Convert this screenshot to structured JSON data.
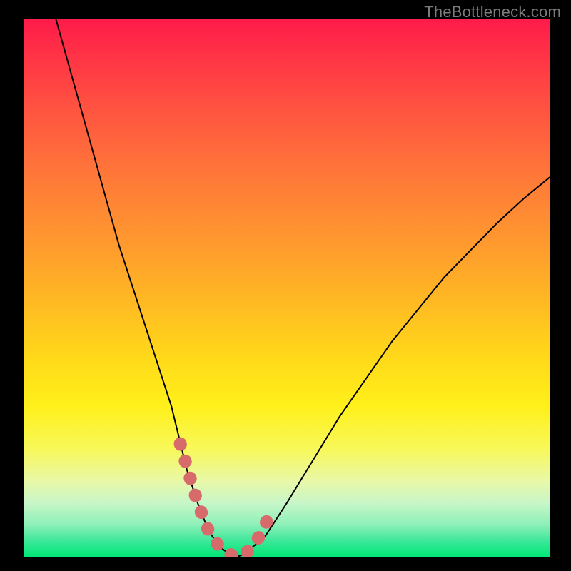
{
  "watermark": "TheBottleneck.com",
  "chart_data": {
    "type": "line",
    "title": "",
    "xlabel": "",
    "ylabel": "",
    "xlim": [
      0,
      100
    ],
    "ylim": [
      0,
      100
    ],
    "grid": false,
    "series": [
      {
        "name": "bottleneck-curve",
        "color": "#000000",
        "stroke_width": 2,
        "x": [
          6,
          8,
          10,
          12,
          14,
          16,
          18,
          20,
          22,
          24,
          26,
          28,
          29.5,
          31,
          33,
          35,
          37,
          39,
          40.5,
          42,
          46,
          50,
          55,
          60,
          65,
          70,
          75,
          80,
          85,
          90,
          95,
          100
        ],
        "y": [
          100,
          93,
          86,
          79,
          72,
          65,
          58,
          52,
          46,
          40,
          34,
          28,
          22,
          16,
          10,
          5,
          2,
          0.5,
          0,
          0.5,
          4,
          10,
          18,
          26,
          33,
          40,
          46,
          52,
          57,
          62,
          66.5,
          70.5
        ]
      },
      {
        "name": "sweet-spot-marker",
        "color": "#d76a6a",
        "stroke_width": 18,
        "stroke_linecap": "round",
        "x": [
          29.7,
          31.3,
          33.0,
          35.0,
          37.0,
          39.0,
          40.5,
          42.0,
          43.6,
          45.2,
          46.8
        ],
        "y": [
          21.0,
          15.5,
          10.0,
          5.0,
          2.0,
          0.5,
          0.0,
          0.5,
          2.0,
          4.5,
          8.0
        ]
      }
    ],
    "background_axis": "vertical-rainbow-gradient"
  }
}
